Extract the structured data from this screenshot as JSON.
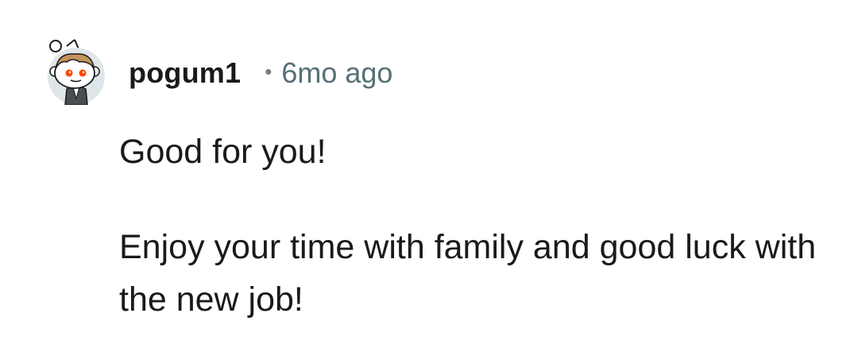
{
  "comment": {
    "avatar_icon": "snoo-avatar-icon",
    "username": "pogum1",
    "separator": "•",
    "timestamp": "6mo ago",
    "paragraphs": [
      "Good for you!",
      "Enjoy your time with family and good luck with the new job!"
    ]
  },
  "colors": {
    "username": "#1a1a1b",
    "timestamp": "#576f76",
    "body_text": "#1a1a1b",
    "avatar_bg": "#dfe6e9",
    "avatar_eyes": "#ff4500"
  }
}
